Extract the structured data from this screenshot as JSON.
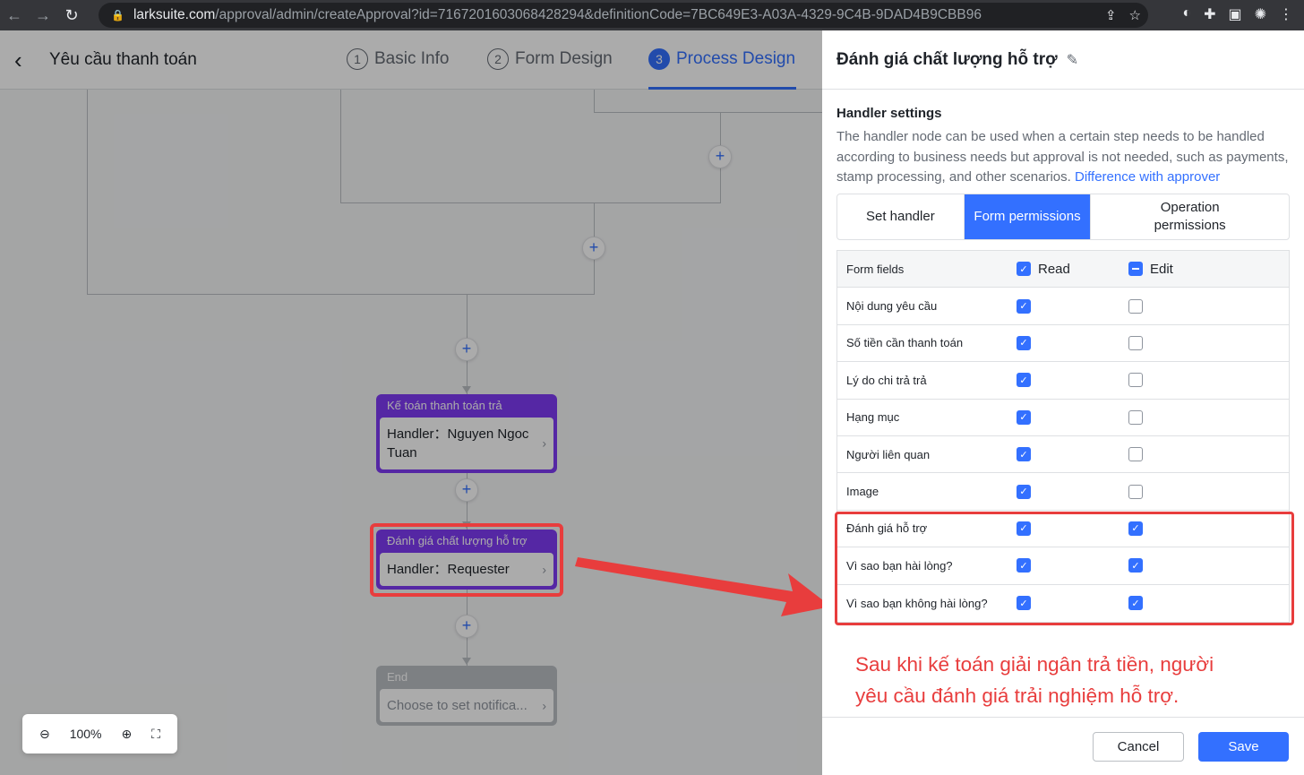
{
  "browser": {
    "url_host": "larksuite.com",
    "url_path": "/approval/admin/createApproval?id=7167201603068428294&definitionCode=7BC649E3-A03A-4329-9C4B-9DAD4B9CBB96"
  },
  "header": {
    "title": "Yêu cầu thanh toán",
    "steps": [
      {
        "num": "1",
        "label": "Basic Info"
      },
      {
        "num": "2",
        "label": "Form Design"
      },
      {
        "num": "3",
        "label": "Process Design"
      }
    ]
  },
  "canvas": {
    "nodes": [
      {
        "title": "Kế toán thanh toán trả",
        "body": "Handler：Nguyen Ngoc Tuan"
      },
      {
        "title": "Đánh giá chất lượng hỗ trợ",
        "body": "Handler：Requester"
      },
      {
        "title": "End",
        "body": "Choose to set notifica..."
      }
    ],
    "zoom": "100%"
  },
  "panel": {
    "title": "Đánh giá chất lượng hỗ trợ",
    "section_title": "Handler settings",
    "description": "The handler node can be used when a certain step needs to be handled according to business needs but approval is not needed, such as payments, stamp processing, and other scenarios.",
    "description_link": "Difference with approver",
    "tabs": [
      "Set handler",
      "Form permissions",
      "Operation permissions"
    ],
    "table": {
      "col_name": "Form fields",
      "col_read": "Read",
      "col_edit": "Edit",
      "rows": [
        {
          "name": "Nội dung yêu cầu",
          "read": true,
          "edit": false
        },
        {
          "name": "Số tiền cần thanh toán",
          "read": true,
          "edit": false
        },
        {
          "name": "Lý do chi trả trả",
          "read": true,
          "edit": false
        },
        {
          "name": "Hạng mục",
          "read": true,
          "edit": false
        },
        {
          "name": "Người liên quan",
          "read": true,
          "edit": false
        },
        {
          "name": "Image",
          "read": true,
          "edit": false
        },
        {
          "name": "Đánh giá hỗ trợ",
          "read": true,
          "edit": true
        },
        {
          "name": "Vì sao bạn hài lòng?",
          "read": true,
          "edit": true
        },
        {
          "name": "Vì sao bạn không hài lòng?",
          "read": true,
          "edit": true
        }
      ]
    },
    "annotation": "Sau khi kế toán giải ngân trả tiền, người yêu cầu đánh giá trải nghiệm hỗ trợ.",
    "cancel_label": "Cancel",
    "save_label": "Save"
  },
  "colors": {
    "accent": "#3370ff",
    "node": "#7f3bf5",
    "highlight": "#e83d3d"
  }
}
